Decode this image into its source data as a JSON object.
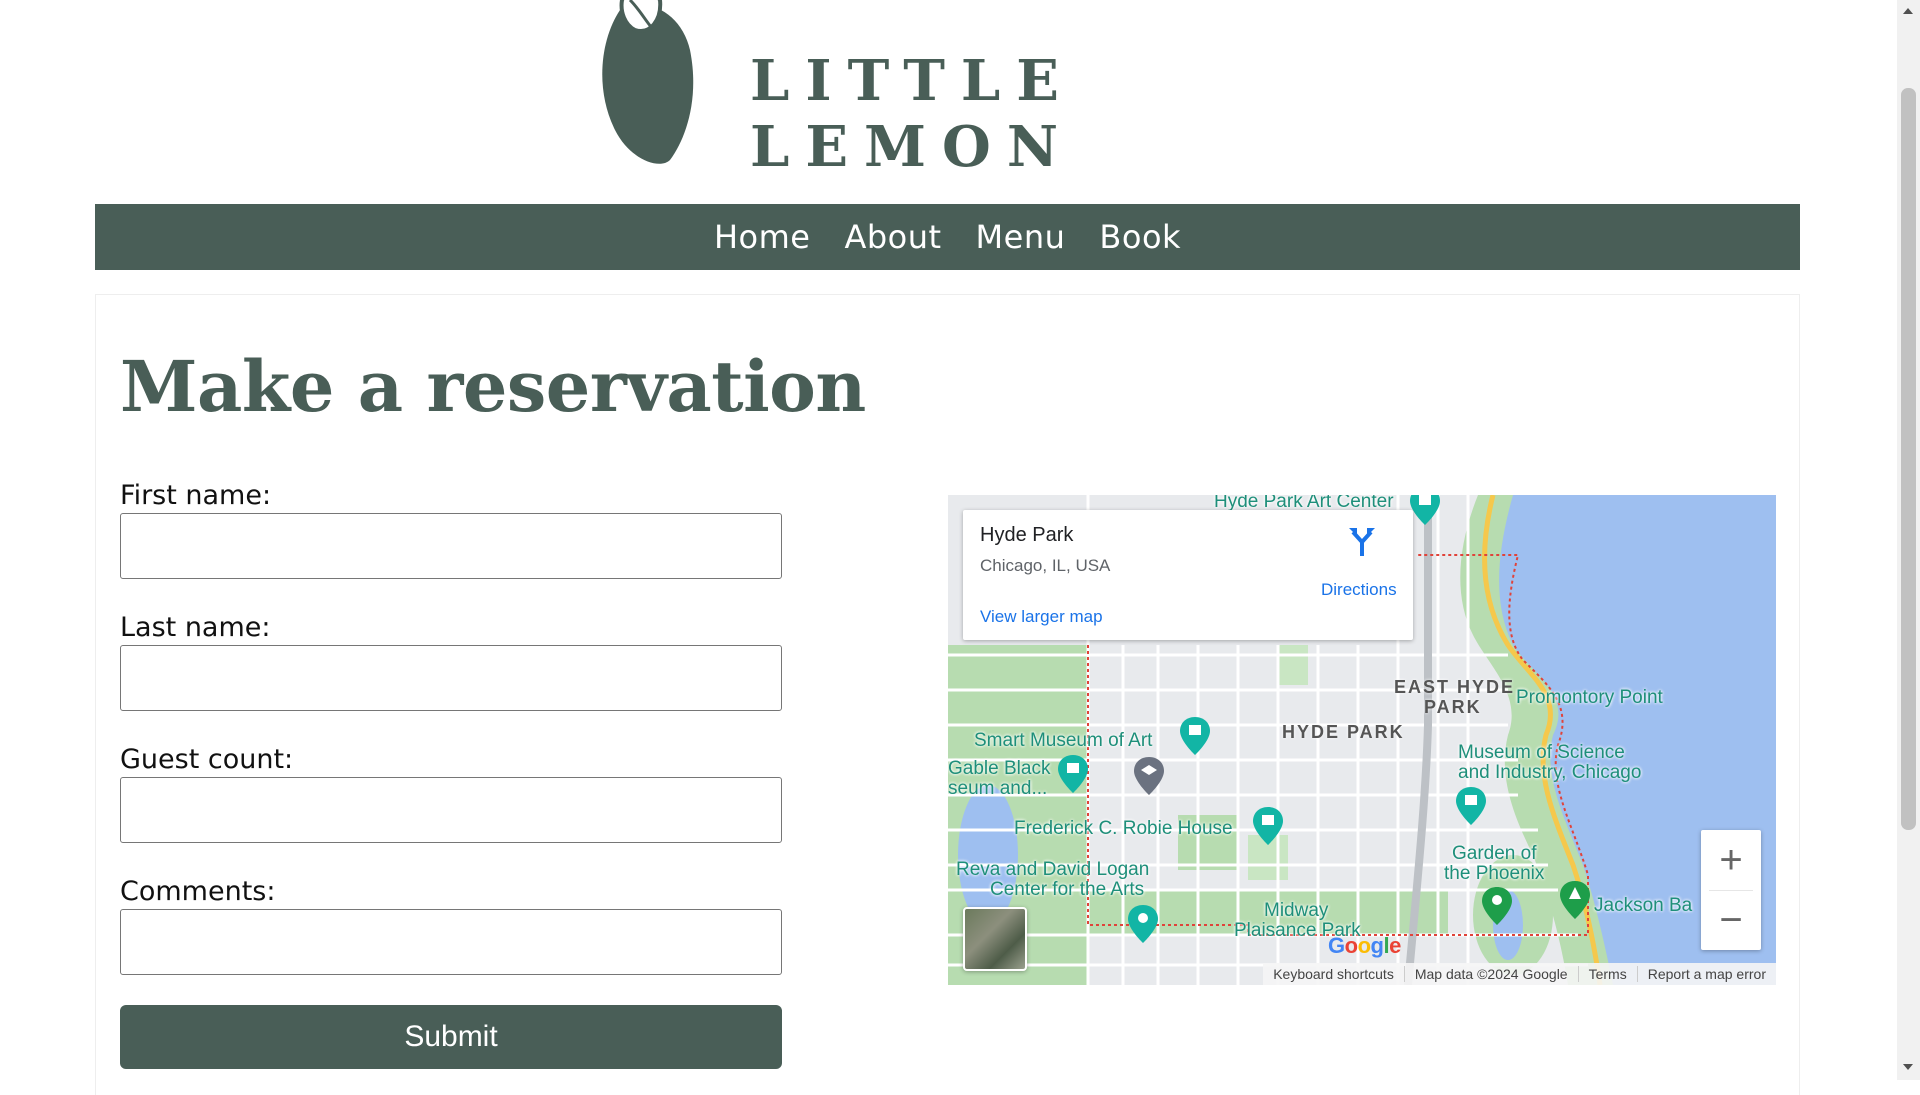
{
  "brand": {
    "logo_text": "LITTLE LEMON",
    "color": "#495e57"
  },
  "nav": {
    "items": [
      "Home",
      "About",
      "Menu",
      "Book"
    ]
  },
  "page": {
    "title": "Make a reservation"
  },
  "form": {
    "fields": [
      {
        "label": "First name:",
        "value": ""
      },
      {
        "label": "Last name:",
        "value": ""
      },
      {
        "label": "Guest count:",
        "value": ""
      },
      {
        "label": "Comments:",
        "value": ""
      }
    ],
    "submit_label": "Submit"
  },
  "map": {
    "place_title": "Hyde Park",
    "place_subtitle": "Chicago, IL, USA",
    "directions_label": "Directions",
    "larger_map_link": "View larger map",
    "labels": {
      "hyde_park_art_center": "Hyde Park Art Center",
      "east_hyde_park_1": "EAST HYDE",
      "east_hyde_park_2": "PARK",
      "promontory_point": "Promontory Point",
      "hyde_park": "HYDE PARK",
      "smart_museum": "Smart Museum of Art",
      "museum_sci_1": "Museum of Science",
      "museum_sci_2": "and Industry, Chicago",
      "gable_black_1": "Gable Black",
      "gable_black_2": "seum and...",
      "robie_house": "Frederick C. Robie House",
      "logan_1": "Reva and David Logan",
      "logan_2": "Center for the Arts",
      "garden_1": "Garden of",
      "garden_2": "the Phoenix",
      "jackson": "Jackson Ba",
      "midway_1": "Midway",
      "midway_2": "Plaisance Park"
    },
    "google_logo": [
      "G",
      "o",
      "o",
      "g",
      "l",
      "e"
    ],
    "attribution": [
      "Keyboard shortcuts",
      "Map data ©2024 Google",
      "Terms",
      "Report a map error"
    ],
    "zoom_in": "+",
    "zoom_out": "−",
    "colors": {
      "water": "#9ebff0",
      "park": "#b7dcb0",
      "road": "#ffffff",
      "land": "#e8eaed",
      "highway": "#f5c84c"
    }
  }
}
